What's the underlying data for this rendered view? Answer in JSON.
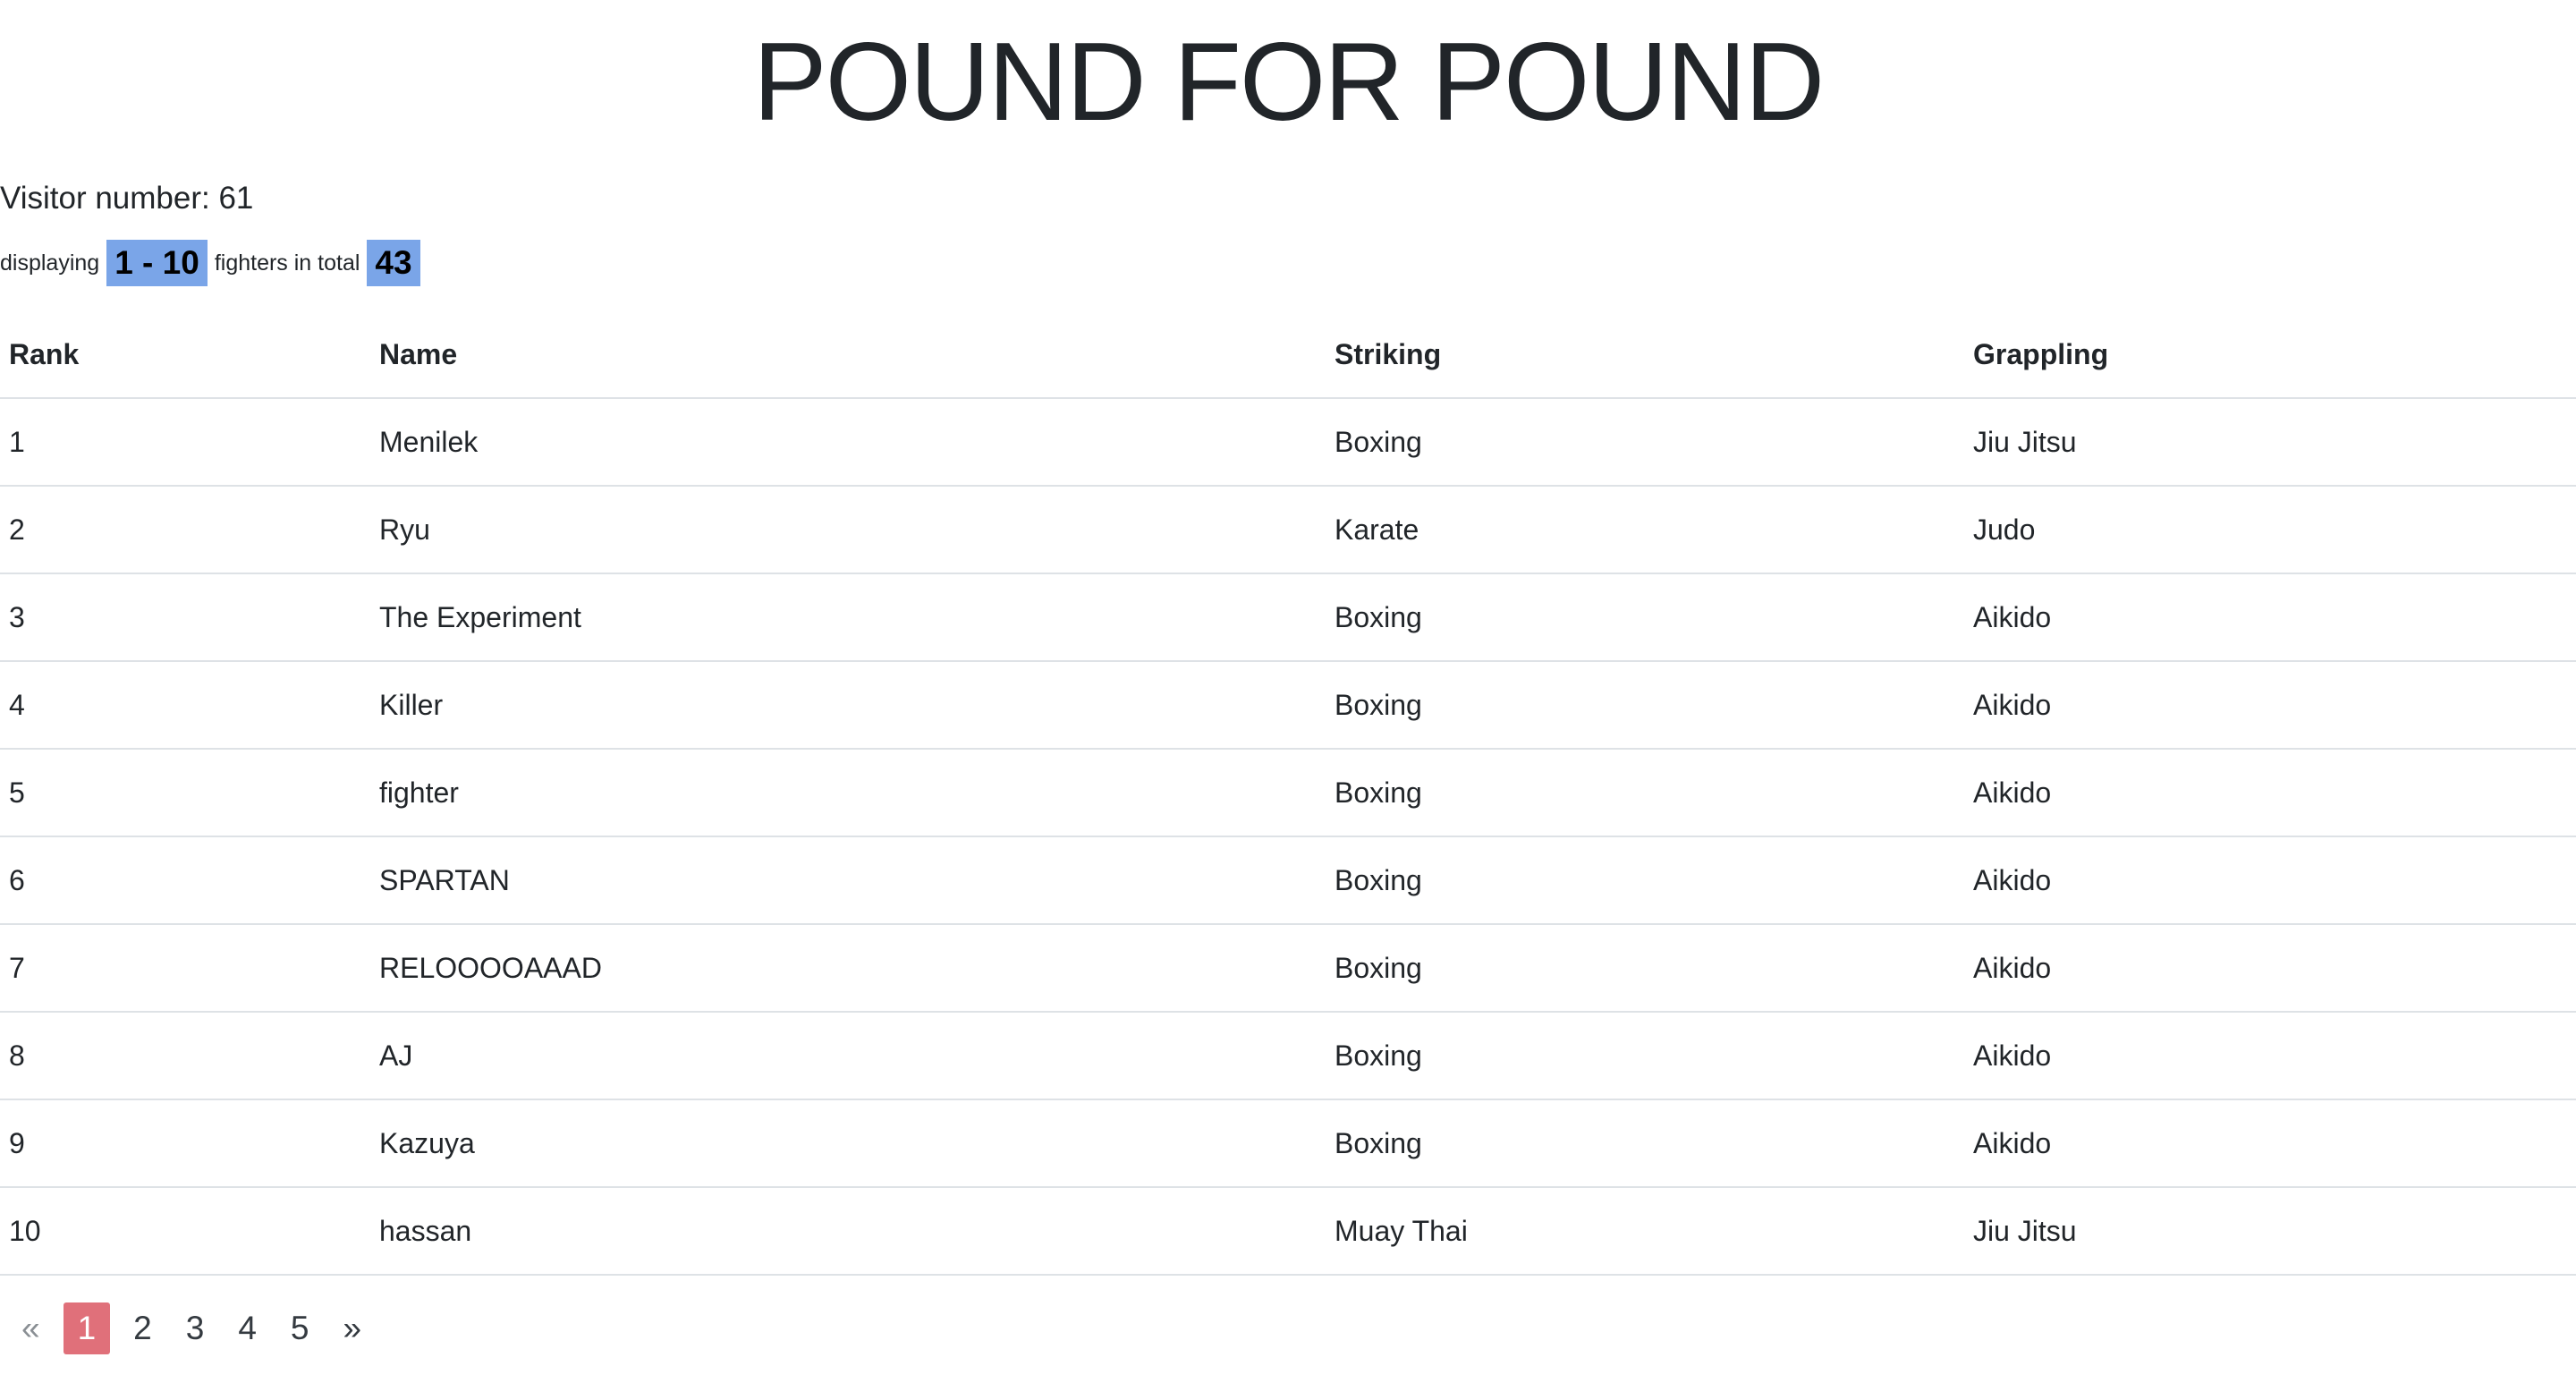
{
  "header": {
    "title": "POUND FOR POUND"
  },
  "visitor": {
    "text": "Visitor number: 61"
  },
  "display": {
    "prefix": "displaying",
    "range": "1 - 10",
    "middle": "fighters in total",
    "total": "43"
  },
  "table": {
    "columns": [
      "Rank",
      "Name",
      "Striking",
      "Grappling"
    ],
    "rows": [
      [
        "1",
        "Menilek",
        "Boxing",
        "Jiu Jitsu"
      ],
      [
        "2",
        "Ryu",
        "Karate",
        "Judo"
      ],
      [
        "3",
        "The Experiment",
        "Boxing",
        "Aikido"
      ],
      [
        "4",
        "Killer",
        "Boxing",
        "Aikido"
      ],
      [
        "5",
        "fighter",
        "Boxing",
        "Aikido"
      ],
      [
        "6",
        "SPARTAN",
        "Boxing",
        "Aikido"
      ],
      [
        "7",
        "RELOOOOAAAD",
        "Boxing",
        "Aikido"
      ],
      [
        "8",
        "AJ",
        "Boxing",
        "Aikido"
      ],
      [
        "9",
        "Kazuya",
        "Boxing",
        "Aikido"
      ],
      [
        "10",
        "hassan",
        "Muay Thai",
        "Jiu Jitsu"
      ]
    ]
  },
  "pagination": {
    "prev": "«",
    "pages": [
      "1",
      "2",
      "3",
      "4",
      "5"
    ],
    "next": "»",
    "current": "1",
    "active_color": "#e0707a"
  },
  "colors": {
    "badge": "#7aa5e8",
    "text": "#212529",
    "border": "#dee2e6"
  }
}
